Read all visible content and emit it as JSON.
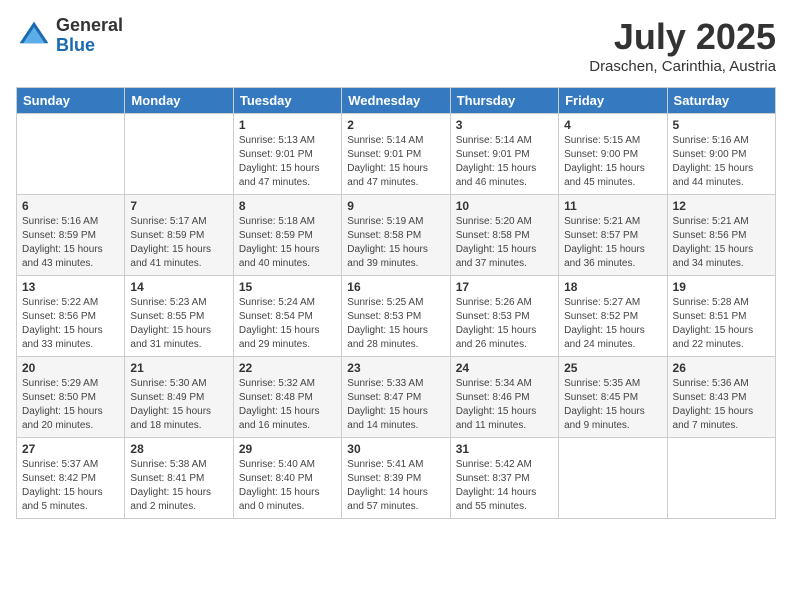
{
  "header": {
    "logo_general": "General",
    "logo_blue": "Blue",
    "month_title": "July 2025",
    "location": "Draschen, Carinthia, Austria"
  },
  "days_of_week": [
    "Sunday",
    "Monday",
    "Tuesday",
    "Wednesday",
    "Thursday",
    "Friday",
    "Saturday"
  ],
  "weeks": [
    [
      {
        "day": "",
        "info": ""
      },
      {
        "day": "",
        "info": ""
      },
      {
        "day": "1",
        "info": "Sunrise: 5:13 AM\nSunset: 9:01 PM\nDaylight: 15 hours and 47 minutes."
      },
      {
        "day": "2",
        "info": "Sunrise: 5:14 AM\nSunset: 9:01 PM\nDaylight: 15 hours and 47 minutes."
      },
      {
        "day": "3",
        "info": "Sunrise: 5:14 AM\nSunset: 9:01 PM\nDaylight: 15 hours and 46 minutes."
      },
      {
        "day": "4",
        "info": "Sunrise: 5:15 AM\nSunset: 9:00 PM\nDaylight: 15 hours and 45 minutes."
      },
      {
        "day": "5",
        "info": "Sunrise: 5:16 AM\nSunset: 9:00 PM\nDaylight: 15 hours and 44 minutes."
      }
    ],
    [
      {
        "day": "6",
        "info": "Sunrise: 5:16 AM\nSunset: 8:59 PM\nDaylight: 15 hours and 43 minutes."
      },
      {
        "day": "7",
        "info": "Sunrise: 5:17 AM\nSunset: 8:59 PM\nDaylight: 15 hours and 41 minutes."
      },
      {
        "day": "8",
        "info": "Sunrise: 5:18 AM\nSunset: 8:59 PM\nDaylight: 15 hours and 40 minutes."
      },
      {
        "day": "9",
        "info": "Sunrise: 5:19 AM\nSunset: 8:58 PM\nDaylight: 15 hours and 39 minutes."
      },
      {
        "day": "10",
        "info": "Sunrise: 5:20 AM\nSunset: 8:58 PM\nDaylight: 15 hours and 37 minutes."
      },
      {
        "day": "11",
        "info": "Sunrise: 5:21 AM\nSunset: 8:57 PM\nDaylight: 15 hours and 36 minutes."
      },
      {
        "day": "12",
        "info": "Sunrise: 5:21 AM\nSunset: 8:56 PM\nDaylight: 15 hours and 34 minutes."
      }
    ],
    [
      {
        "day": "13",
        "info": "Sunrise: 5:22 AM\nSunset: 8:56 PM\nDaylight: 15 hours and 33 minutes."
      },
      {
        "day": "14",
        "info": "Sunrise: 5:23 AM\nSunset: 8:55 PM\nDaylight: 15 hours and 31 minutes."
      },
      {
        "day": "15",
        "info": "Sunrise: 5:24 AM\nSunset: 8:54 PM\nDaylight: 15 hours and 29 minutes."
      },
      {
        "day": "16",
        "info": "Sunrise: 5:25 AM\nSunset: 8:53 PM\nDaylight: 15 hours and 28 minutes."
      },
      {
        "day": "17",
        "info": "Sunrise: 5:26 AM\nSunset: 8:53 PM\nDaylight: 15 hours and 26 minutes."
      },
      {
        "day": "18",
        "info": "Sunrise: 5:27 AM\nSunset: 8:52 PM\nDaylight: 15 hours and 24 minutes."
      },
      {
        "day": "19",
        "info": "Sunrise: 5:28 AM\nSunset: 8:51 PM\nDaylight: 15 hours and 22 minutes."
      }
    ],
    [
      {
        "day": "20",
        "info": "Sunrise: 5:29 AM\nSunset: 8:50 PM\nDaylight: 15 hours and 20 minutes."
      },
      {
        "day": "21",
        "info": "Sunrise: 5:30 AM\nSunset: 8:49 PM\nDaylight: 15 hours and 18 minutes."
      },
      {
        "day": "22",
        "info": "Sunrise: 5:32 AM\nSunset: 8:48 PM\nDaylight: 15 hours and 16 minutes."
      },
      {
        "day": "23",
        "info": "Sunrise: 5:33 AM\nSunset: 8:47 PM\nDaylight: 15 hours and 14 minutes."
      },
      {
        "day": "24",
        "info": "Sunrise: 5:34 AM\nSunset: 8:46 PM\nDaylight: 15 hours and 11 minutes."
      },
      {
        "day": "25",
        "info": "Sunrise: 5:35 AM\nSunset: 8:45 PM\nDaylight: 15 hours and 9 minutes."
      },
      {
        "day": "26",
        "info": "Sunrise: 5:36 AM\nSunset: 8:43 PM\nDaylight: 15 hours and 7 minutes."
      }
    ],
    [
      {
        "day": "27",
        "info": "Sunrise: 5:37 AM\nSunset: 8:42 PM\nDaylight: 15 hours and 5 minutes."
      },
      {
        "day": "28",
        "info": "Sunrise: 5:38 AM\nSunset: 8:41 PM\nDaylight: 15 hours and 2 minutes."
      },
      {
        "day": "29",
        "info": "Sunrise: 5:40 AM\nSunset: 8:40 PM\nDaylight: 15 hours and 0 minutes."
      },
      {
        "day": "30",
        "info": "Sunrise: 5:41 AM\nSunset: 8:39 PM\nDaylight: 14 hours and 57 minutes."
      },
      {
        "day": "31",
        "info": "Sunrise: 5:42 AM\nSunset: 8:37 PM\nDaylight: 14 hours and 55 minutes."
      },
      {
        "day": "",
        "info": ""
      },
      {
        "day": "",
        "info": ""
      }
    ]
  ]
}
